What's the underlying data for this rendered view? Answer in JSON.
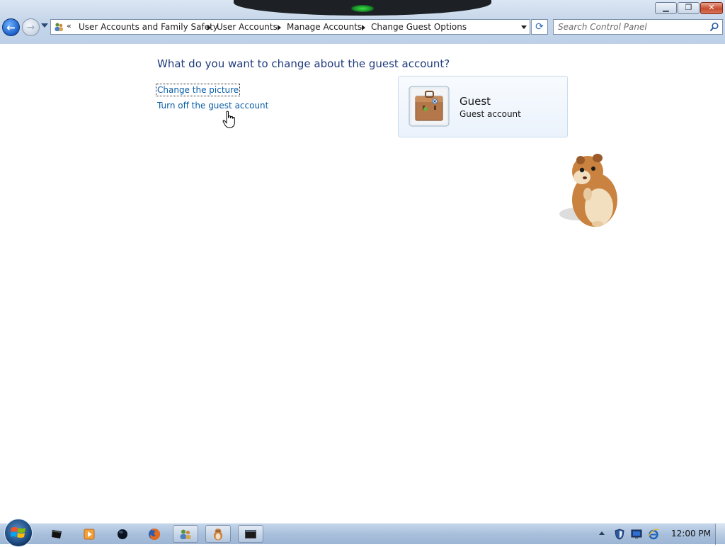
{
  "window": {
    "controls": {
      "minimize": "▁",
      "maximize": "❐",
      "close": "✕"
    }
  },
  "nav": {
    "back_icon": "back-arrow-icon",
    "forward_icon": "forward-arrow-icon",
    "back_glyph": "←",
    "forward_glyph": "→"
  },
  "address": {
    "overflow_chevron": "«",
    "breadcrumbs": [
      "User Accounts and Family Safety",
      "User Accounts",
      "Manage Accounts",
      "Change Guest Options"
    ]
  },
  "refresh_glyph": "⟳",
  "search": {
    "placeholder": "Search Control Panel"
  },
  "content": {
    "heading": "What do you want to change about the guest account?",
    "links": {
      "change_picture": "Change the picture",
      "turn_off_guest": "Turn off the guest account"
    },
    "account": {
      "name": "Guest",
      "type": "Guest account",
      "picture_icon": "briefcase-icon"
    }
  },
  "taskbar": {
    "pinned": [
      "cmd-icon",
      "media-player-icon",
      "black-orb-icon",
      "firefox-icon",
      "user-accounts-icon",
      "hamster-icon",
      "console-window-icon"
    ],
    "tray": [
      "security-shield-icon",
      "network-icon",
      "ie-icon"
    ],
    "clock": "12:00 PM"
  },
  "colors": {
    "link": "#0a5ea8",
    "heading": "#1e3a7a",
    "tile_border": "#c9dcf0",
    "taskbar": "#a9c0dc"
  }
}
